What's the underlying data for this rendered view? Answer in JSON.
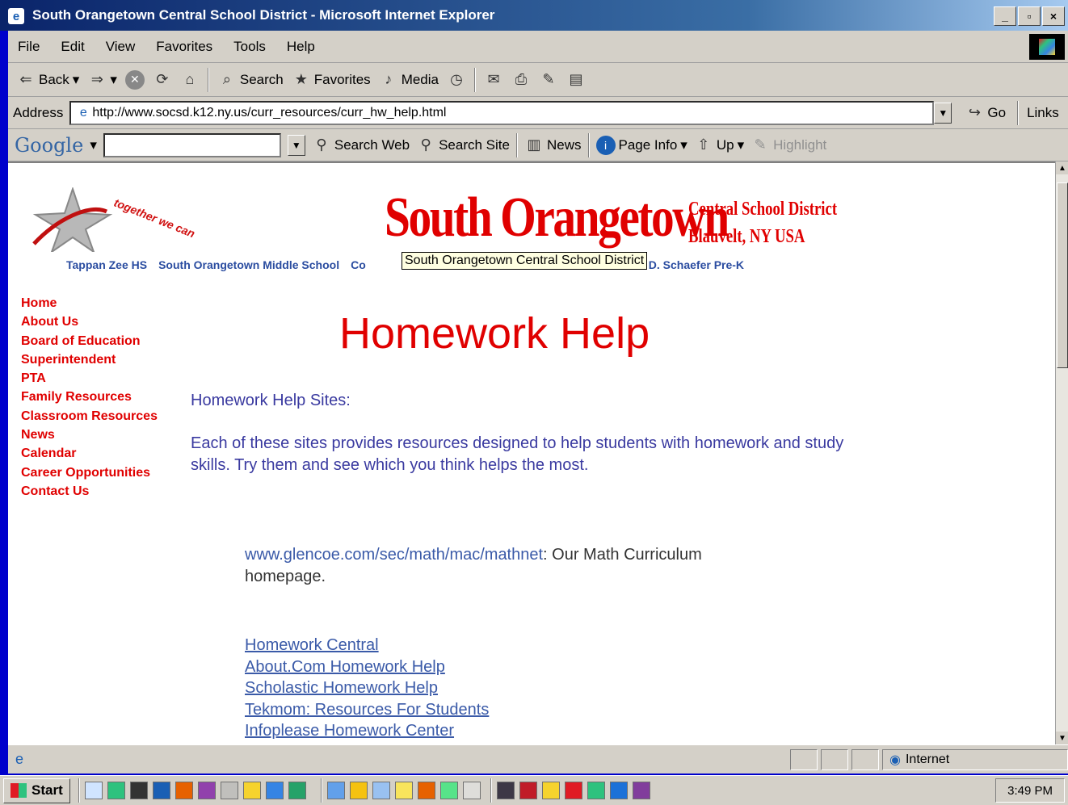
{
  "window": {
    "title": "South Orangetown Central School District - Microsoft Internet Explorer"
  },
  "menu": [
    "File",
    "Edit",
    "View",
    "Favorites",
    "Tools",
    "Help"
  ],
  "toolbar": {
    "back": "Back",
    "search": "Search",
    "favorites": "Favorites",
    "media": "Media"
  },
  "address": {
    "label": "Address",
    "url": "http://www.socsd.k12.ny.us/curr_resources/curr_hw_help.html",
    "go": "Go",
    "links": "Links"
  },
  "google_bar": {
    "logo": "Google",
    "search_web": "Search Web",
    "search_site": "Search Site",
    "news": "News",
    "page_info": "Page Info",
    "up": "Up",
    "highlight": "Highlight"
  },
  "site": {
    "tagline": "together we can",
    "brand": "South Orangetown",
    "brand_sub_1": "Central School District",
    "brand_sub_2": "Blauvelt, NY USA",
    "schools": [
      "Tappan Zee HS",
      "South Orangetown Middle School",
      "Co",
      "D. Schaefer Pre-K"
    ],
    "tooltip": "South Orangetown Central School District"
  },
  "nav": [
    "Home",
    "About Us",
    "Board of Education",
    "Superintendent",
    "PTA",
    "Family Resources",
    "Classroom Resources",
    "News",
    "Calendar",
    "Career Opportunities",
    "Contact Us"
  ],
  "content": {
    "title": "Homework Help",
    "section_head": "Homework Help Sites:",
    "intro": "Each of these sites provides resources designed to help students with homework and study skills.  Try them and see which you think helps the most.",
    "math_link": "www.glencoe.com/sec/math/mac/mathnet",
    "math_text": ":  Our Math Curriculum homepage.",
    "links": [
      "Homework Central",
      "About.Com Homework Help",
      "Scholastic Homework Help",
      "Tekmom: Resources For Students",
      "Infoplease Homework Center"
    ]
  },
  "status": {
    "zone": "Internet"
  },
  "taskbar": {
    "start": "Start",
    "clock": "3:49 PM"
  },
  "colors": {
    "brand_red": "#e00000",
    "text_blue": "#3a3aa0",
    "link_blue": "#3a5aa8"
  }
}
